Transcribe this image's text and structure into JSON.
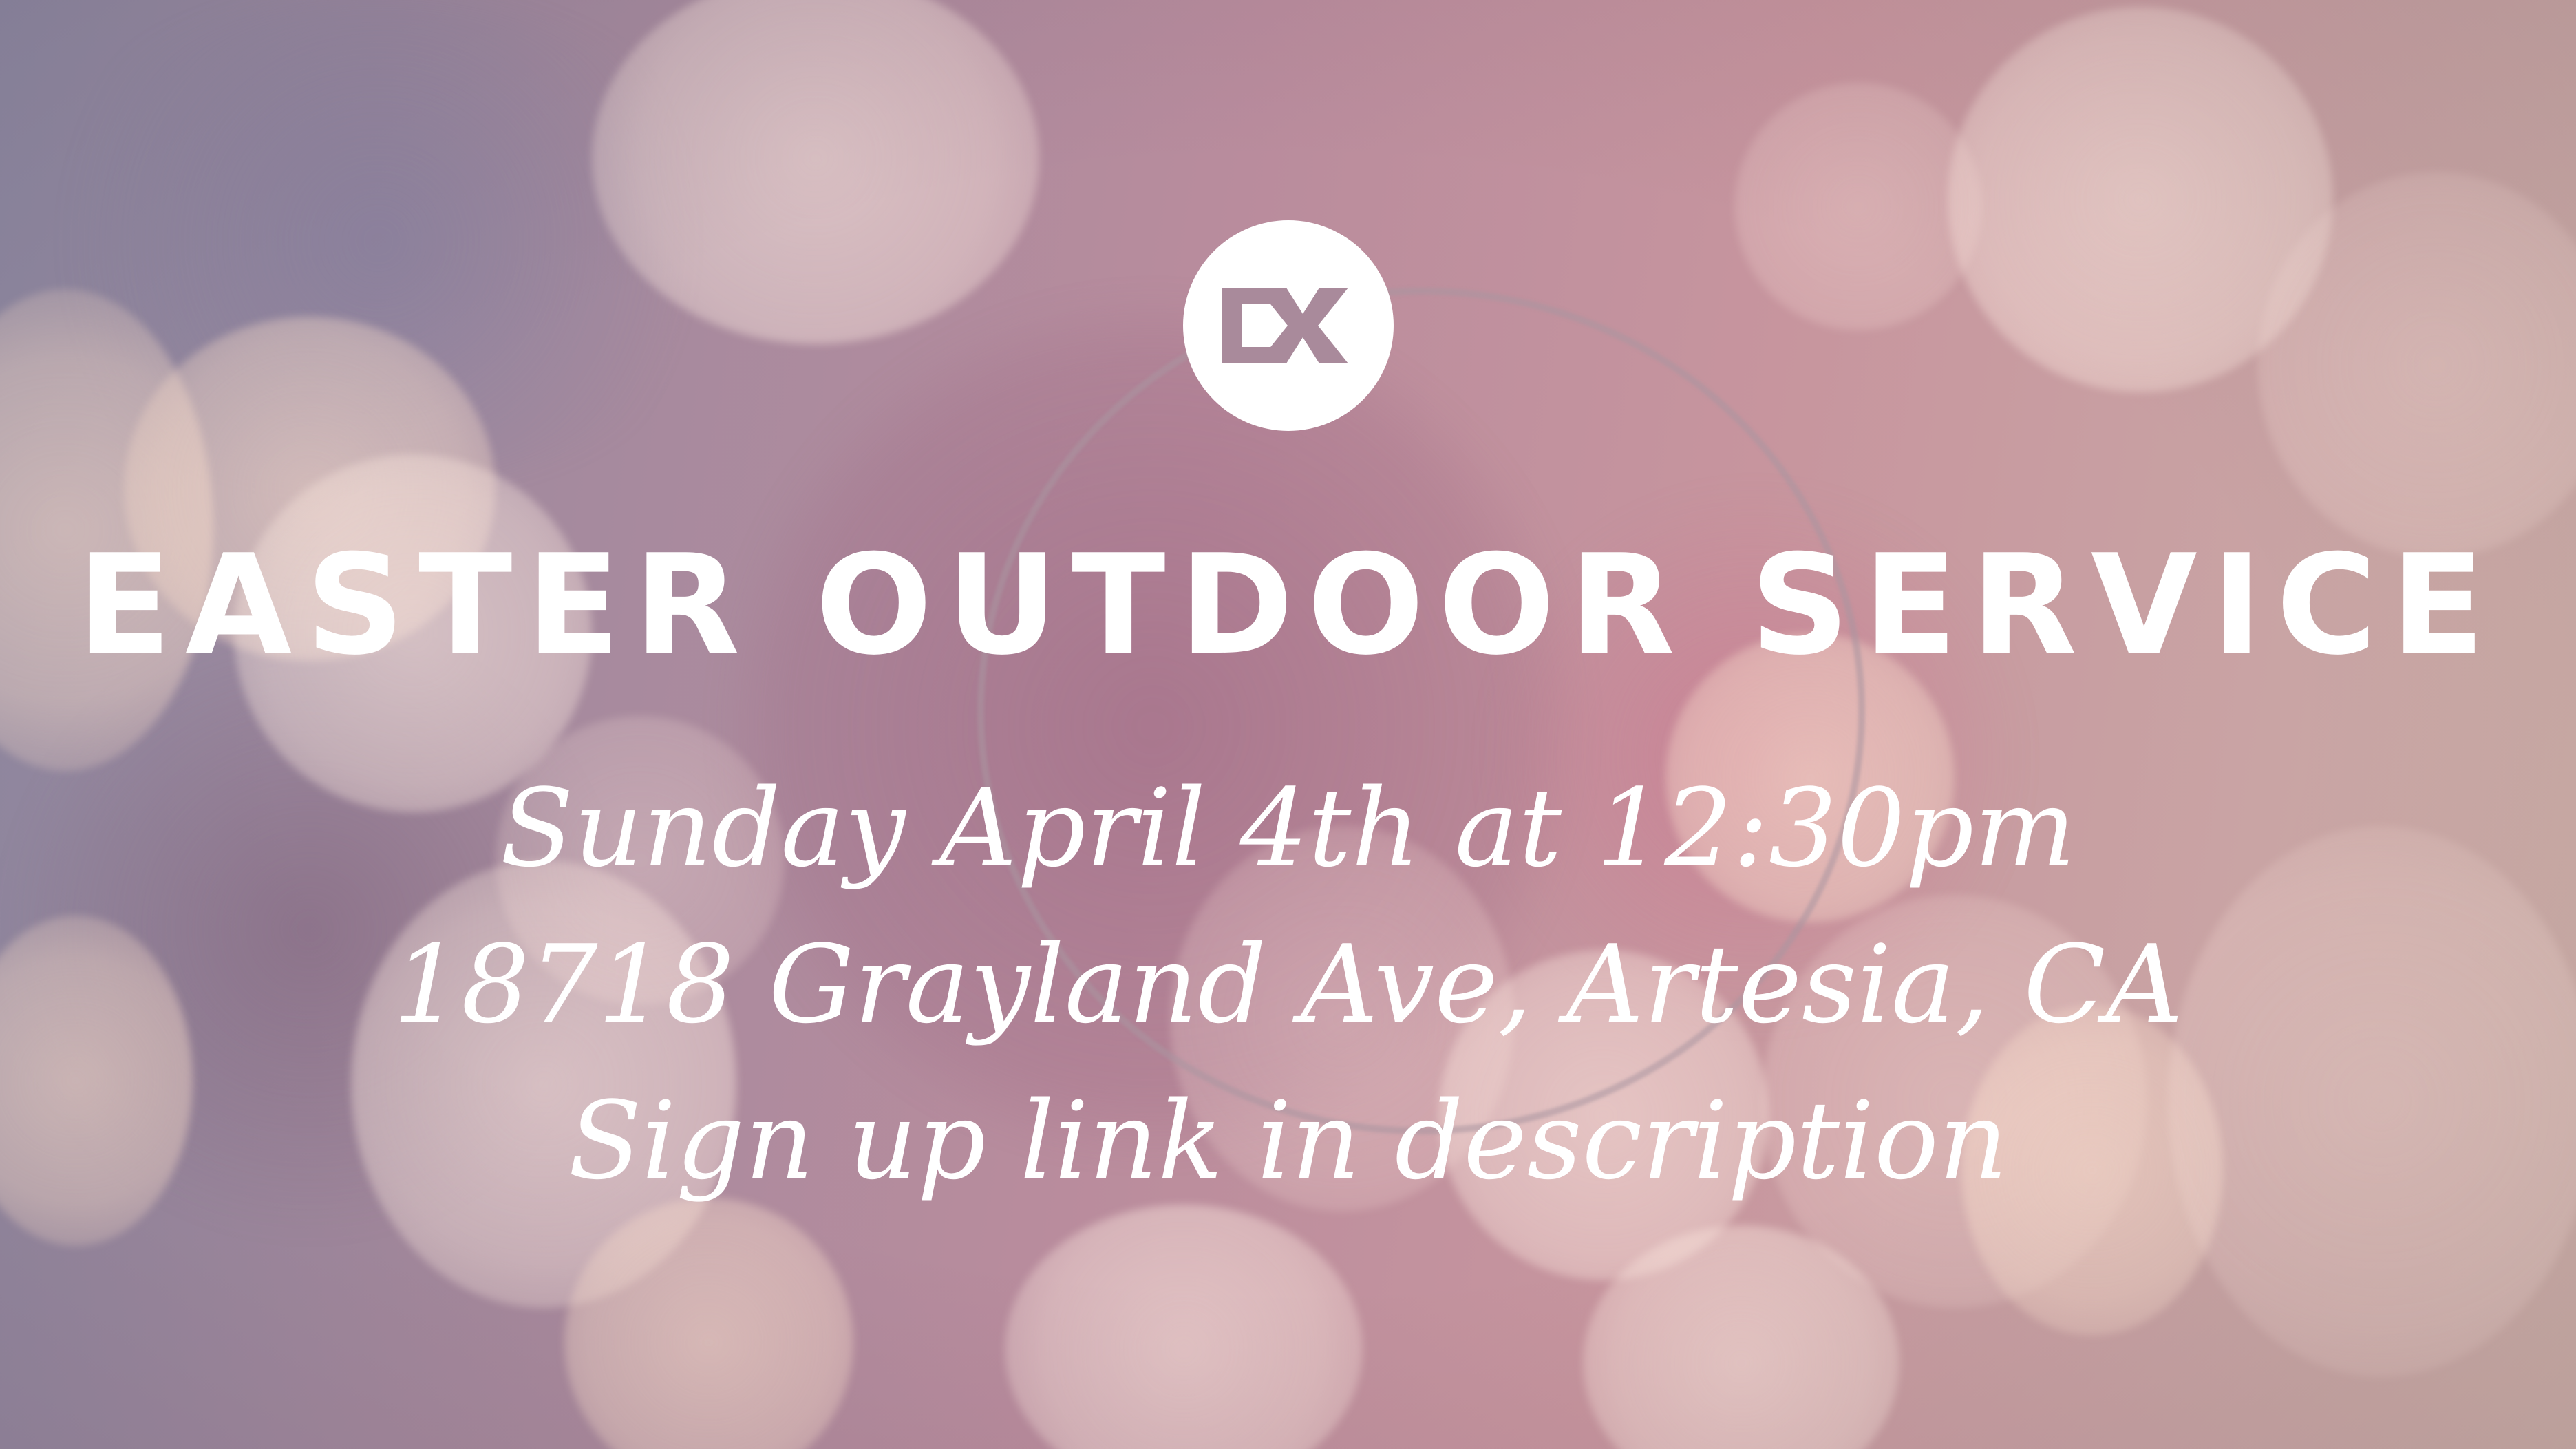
{
  "slide": {
    "logo": {
      "icon": "cx-logo-icon",
      "text": "CX",
      "background_color": "#ffffff",
      "mark_color": "#a98a9b"
    },
    "title": "EASTER OUTDOOR SERVICE",
    "details": [
      "Sunday April 4th at 12:30pm",
      "18718 Grayland Ave, Artesia, CA",
      "Sign up link in description"
    ],
    "text_color": "#ffffff"
  }
}
